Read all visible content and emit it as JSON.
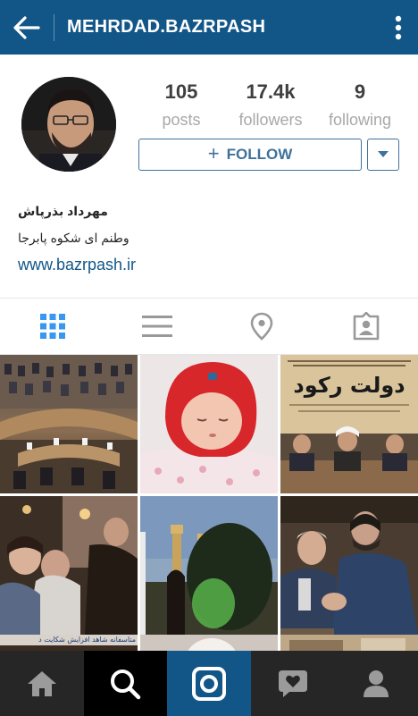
{
  "header": {
    "title": "MEHRDAD.BAZRPASH",
    "back_icon": "back-arrow-icon",
    "menu_icon": "overflow-menu-icon",
    "background": "#125688"
  },
  "profile": {
    "stats": {
      "posts_count": "105",
      "posts_label": "posts",
      "followers_count": "17.4k",
      "followers_label": "followers",
      "following_count": "9",
      "following_label": "following"
    },
    "follow_button": {
      "plus": "+",
      "label": "FOLLOW"
    },
    "bio": {
      "name": "مهرداد بذرپاش",
      "text": "وطنم ای شکوه پابرجا",
      "website": "www.bazrpash.ir"
    }
  },
  "view_tabs": [
    {
      "icon": "grid-view-icon",
      "active": true
    },
    {
      "icon": "list-view-icon",
      "active": false
    },
    {
      "icon": "location-pin-icon",
      "active": false
    },
    {
      "icon": "tagged-photos-icon",
      "active": false
    }
  ],
  "grid_posts": {
    "post3_headline": "دولت رکود",
    "post7_caption": "متاسفانه شاهد افزایش شکایت د"
  },
  "bottom_nav": [
    {
      "icon": "home-icon"
    },
    {
      "icon": "search-icon",
      "active": true
    },
    {
      "icon": "camera-icon",
      "active": true
    },
    {
      "icon": "activity-heart-icon"
    },
    {
      "icon": "profile-icon"
    }
  ],
  "colors": {
    "accent": "#3f729b",
    "brand_dark": "#125688",
    "nav_bg": "#262626"
  }
}
